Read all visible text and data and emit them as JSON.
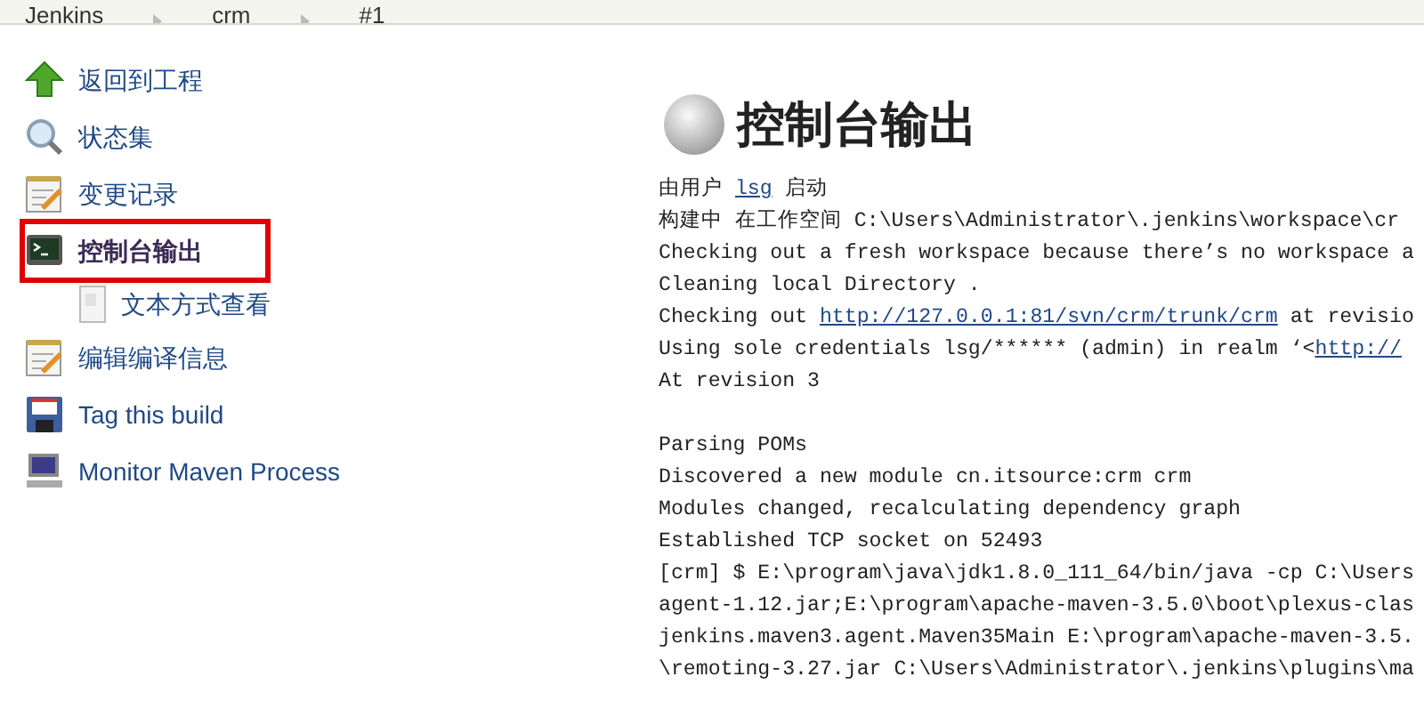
{
  "breadcrumbs": [
    "Jenkins",
    "crm",
    "#1"
  ],
  "sidebar": {
    "items": [
      {
        "label": "返回到工程",
        "selected": false
      },
      {
        "label": "状态集",
        "selected": false
      },
      {
        "label": "变更记录",
        "selected": false
      },
      {
        "label": "控制台输出",
        "selected": true,
        "children": [
          {
            "label": "文本方式查看",
            "selected": false
          }
        ]
      },
      {
        "label": "编辑编译信息",
        "selected": false
      },
      {
        "label": "Tag this build",
        "selected": false
      },
      {
        "label": "Monitor Maven Process",
        "selected": false
      }
    ]
  },
  "page_title": "控制台输出",
  "console_blocks": [
    {
      "lines": [
        [
          {
            "kind": "text",
            "text": "由用户 "
          },
          {
            "kind": "link",
            "text": "lsg"
          },
          {
            "kind": "text",
            "text": " 启动"
          }
        ],
        [
          {
            "kind": "text",
            "text": "构建中 在工作空间 C:\\Users\\Administrator\\.jenkins\\workspace\\cr"
          }
        ],
        [
          {
            "kind": "text",
            "text": "Checking out a fresh workspace because there’s no workspace a"
          }
        ],
        [
          {
            "kind": "text",
            "text": "Cleaning local Directory ."
          }
        ],
        [
          {
            "kind": "text",
            "text": "Checking out "
          },
          {
            "kind": "link",
            "text": "http://127.0.0.1:81/svn/crm/trunk/crm"
          },
          {
            "kind": "text",
            "text": " at revisio"
          }
        ],
        [
          {
            "kind": "text",
            "text": "Using sole credentials lsg/****** (admin) in realm ‘<"
          },
          {
            "kind": "link",
            "text": "http://"
          }
        ],
        [
          {
            "kind": "text",
            "text": "At revision 3"
          }
        ]
      ]
    },
    {
      "lines": [
        [
          {
            "kind": "text",
            "text": "Parsing POMs"
          }
        ],
        [
          {
            "kind": "text",
            "text": "Discovered a new module cn.itsource:crm crm"
          }
        ],
        [
          {
            "kind": "text",
            "text": "Modules changed, recalculating dependency graph"
          }
        ],
        [
          {
            "kind": "text",
            "text": "Established TCP socket on 52493"
          }
        ],
        [
          {
            "kind": "text",
            "text": "[crm] $ E:\\program\\java\\jdk1.8.0_111_64/bin/java -cp C:\\Users"
          }
        ],
        [
          {
            "kind": "text",
            "text": "agent-1.12.jar;E:\\program\\apache-maven-3.5.0\\boot\\plexus-clas"
          }
        ],
        [
          {
            "kind": "text",
            "text": "jenkins.maven3.agent.Maven35Main E:\\program\\apache-maven-3.5."
          }
        ],
        [
          {
            "kind": "text",
            "text": "\\remoting-3.27.jar C:\\Users\\Administrator\\.jenkins\\plugins\\ma"
          }
        ]
      ]
    }
  ]
}
